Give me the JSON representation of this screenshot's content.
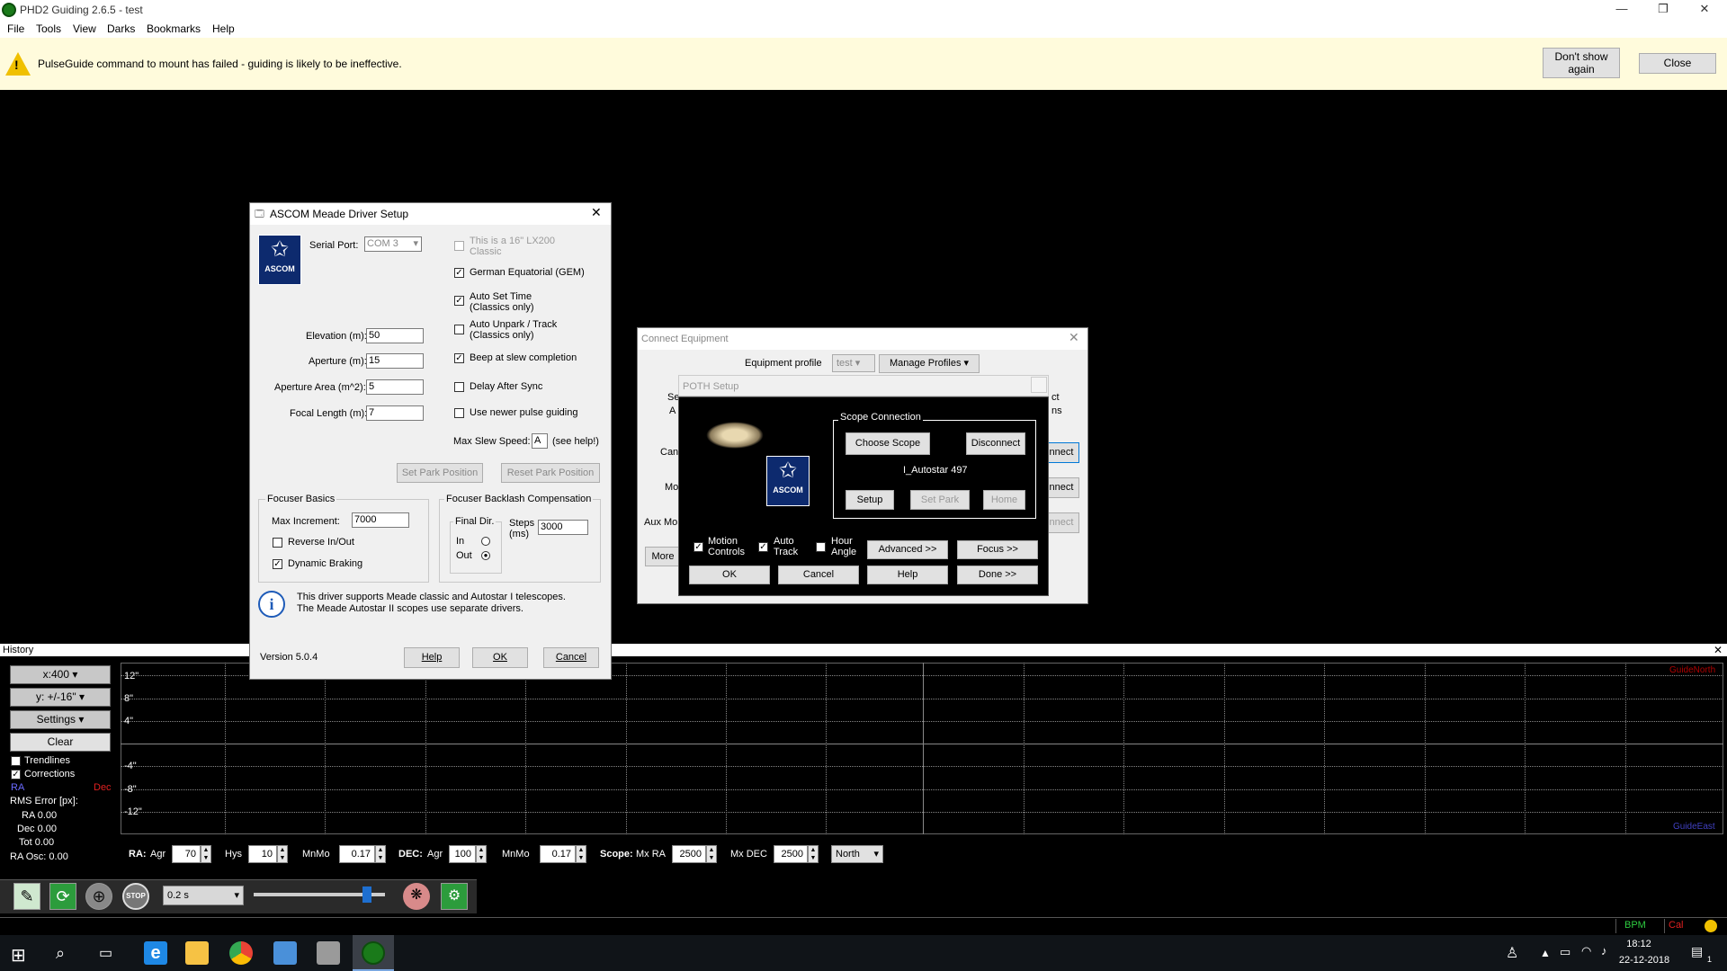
{
  "window": {
    "title": "PHD2 Guiding 2.6.5 - test",
    "min": "—",
    "max": "❐",
    "close": "✕"
  },
  "menu": [
    "File",
    "Tools",
    "View",
    "Darks",
    "Bookmarks",
    "Help"
  ],
  "infobar": {
    "message": "PulseGuide command to mount has failed - guiding is likely to be ineffective.",
    "dont_show": "Don't show again",
    "close": "Close"
  },
  "meade": {
    "title": "ASCOM Meade Driver Setup",
    "serial_label": "Serial Port:",
    "serial_value": "COM 3",
    "elev_label": "Elevation (m):",
    "elev_value": "50",
    "aper_label": "Aperture (m):",
    "aper_value": "15",
    "area_label": "Aperture Area (m^2):",
    "area_value": "5",
    "focal_label": "Focal Length (m):",
    "focal_value": "7",
    "chk_lx200": "This is a 16\" LX200 Classic",
    "chk_gem": "German Equatorial (GEM)",
    "chk_autoset": "Auto Set Time (Classics only)",
    "chk_unpark": "Auto Unpark / Track (Classics only)",
    "chk_beep": "Beep at slew completion",
    "chk_delay": "Delay After Sync",
    "chk_newer": "Use newer pulse guiding",
    "slew_label": "Max Slew Speed:",
    "slew_value": "A",
    "slew_help": "(see help!)",
    "set_park": "Set Park Position",
    "reset_park": "Reset Park Position",
    "focuser_title": "Focuser Basics",
    "max_inc_label": "Max Increment:",
    "max_inc_value": "7000",
    "reverse": "Reverse In/Out",
    "dynamic": "Dynamic Braking",
    "backlash_title": "Focuser Backlash Compensation",
    "final_dir": "Final Dir.",
    "in": "In",
    "out": "Out",
    "steps_label": "Steps (ms)",
    "steps_value": "3000",
    "info": "This driver supports Meade classic and Autostar I telescopes. The Meade Autostar II scopes use separate drivers.",
    "version": "Version 5.0.4",
    "help": "Help",
    "ok": "OK",
    "cancel": "Cancel",
    "logo": "ASCOM"
  },
  "connect": {
    "title": "Connect Equipment",
    "profile_label": "Equipment profile",
    "profile_value": "test",
    "manage": "Manage Profiles",
    "partial": [
      "Se",
      "A",
      "Can",
      "Mo",
      "Aux Mo",
      "More"
    ],
    "right_partial": [
      "ct",
      "ns",
      "nnect",
      "nnect",
      "nnect"
    ]
  },
  "poth": {
    "title": "POTH Setup",
    "scope_conn": "Scope Connection",
    "choose": "Choose Scope",
    "disconnect": "Disconnect",
    "scope_name": "I_Autostar 497",
    "setup": "Setup",
    "set_park": "Set Park",
    "home": "Home",
    "motion": "Motion Controls",
    "auto_track": "Auto Track",
    "hour_angle": "Hour Angle",
    "advanced": "Advanced >>",
    "focus": "Focus >>",
    "ok": "OK",
    "cancel": "Cancel",
    "help": "Help",
    "done": "Done >>",
    "logo": "ASCOM"
  },
  "history": {
    "title": "History",
    "x_scale": "x:400",
    "y_scale": "y: +/-16\"",
    "settings": "Settings",
    "clear": "Clear",
    "trendlines": "Trendlines",
    "corrections": "Corrections",
    "ra": "RA",
    "dec": "Dec",
    "rms": "RMS Error [px]:",
    "ra_val": "RA  0.00",
    "dec_val": "Dec  0.00",
    "tot_val": "Tot  0.00",
    "ra_osc": "RA Osc: 0.00",
    "y_labels": [
      "12\"",
      "8\"",
      "4\"",
      "-4\"",
      "-8\"",
      "-12\""
    ],
    "guide_north": "GuideNorth",
    "guide_east": "GuideEast"
  },
  "controls": {
    "ra_label": "RA:",
    "agr": "Agr",
    "ra_agr": "70",
    "hys": "Hys",
    "hys_val": "10",
    "mnmo": "MnMo",
    "ra_mnmo": "0.17",
    "dec_label": "DEC:",
    "dec_agr": "100",
    "dec_mnmo": "0.17",
    "scope_label": "Scope:",
    "mx_ra": "Mx RA",
    "mx_ra_val": "2500",
    "mx_dec": "Mx DEC",
    "mx_dec_val": "2500",
    "north": "North"
  },
  "toolbar": {
    "exposure": "0.2 s",
    "stop": "STOP"
  },
  "status": {
    "bpm": "BPM",
    "cal": "Cal"
  },
  "taskbar": {
    "time": "18:12",
    "date": "22-12-2018",
    "notif": "1"
  }
}
